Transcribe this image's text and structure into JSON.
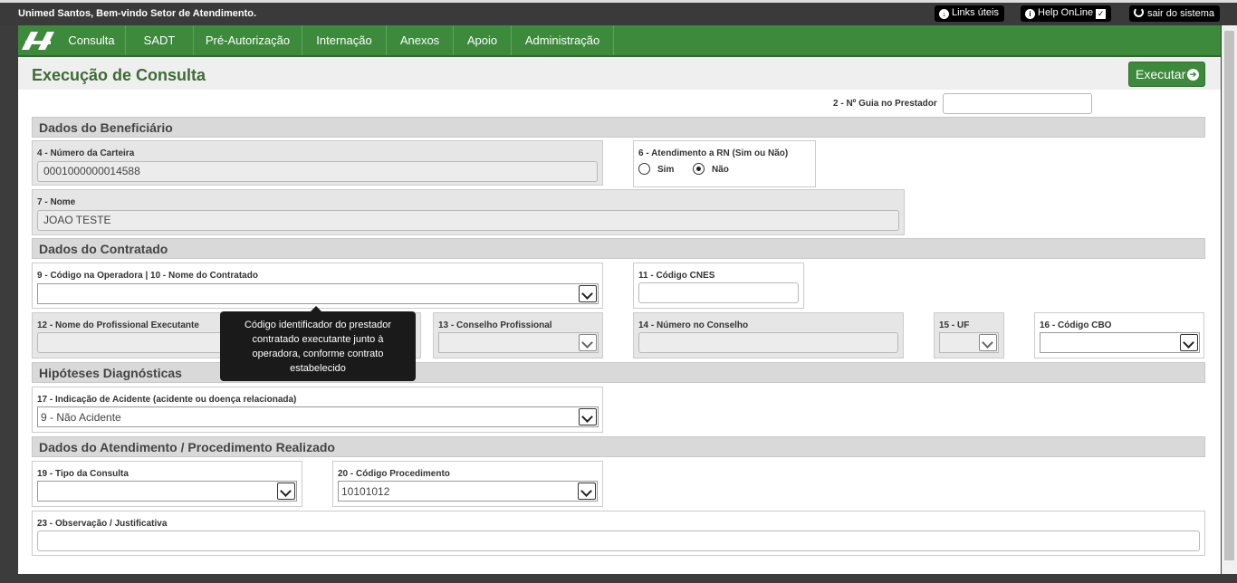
{
  "header": {
    "welcome": "Unimed Santos, Bem-vindo Setor de Atendimento.",
    "links_uteis": "Links úteis",
    "help_online": "Help OnLine",
    "sair": "sair do sistema"
  },
  "nav": {
    "items": [
      "Consulta",
      "SADT",
      "Pré-Autorização",
      "Internação",
      "Anexos",
      "Apoio",
      "Administração"
    ]
  },
  "page": {
    "title": "Execução de Consulta",
    "execute_label": "Executar",
    "guia_label": "2 - Nº Guia no Prestador",
    "guia_value": ""
  },
  "sections": {
    "beneficiario": "Dados do Beneficiário",
    "contratado": "Dados do Contratado",
    "hipoteses": "Hipóteses Diagnósticas",
    "atendimento": "Dados do Atendimento / Procedimento Realizado"
  },
  "fields": {
    "carteira_label": "4 - Número da Carteira",
    "carteira_value": "0001000000014588",
    "rn_label": "6 - Atendimento a RN (Sim ou Não)",
    "rn_sim": "Sim",
    "rn_nao": "Não",
    "rn_selected": "Não",
    "nome_label": "7 - Nome",
    "nome_value": "JOAO TESTE",
    "codigo_operadora_label": "9 - Código na Operadora | 10 - Nome do Contratado",
    "codigo_operadora_value": "",
    "cnes_label": "11 - Código CNES",
    "cnes_value": "",
    "profissional_label": "12 - Nome do Profissional Executante",
    "conselho_label": "13 - Conselho Profissional",
    "numero_conselho_label": "14 - Número no Conselho",
    "uf_label": "15 - UF",
    "cbo_label": "16 - Código CBO",
    "acidente_label": "17 - Indicação de Acidente (acidente ou doença relacionada)",
    "acidente_value": "9 - Não Acidente",
    "tipo_consulta_label": "19 - Tipo da Consulta",
    "tipo_consulta_value": "",
    "procedimento_label": "20 - Código Procedimento",
    "procedimento_value": "10101012",
    "observacao_label": "23 - Observação / Justificativa",
    "observacao_value": ""
  },
  "tooltip": {
    "text": "Código identificador do prestador contratado executante junto à operadora, conforme contrato estabelecido"
  },
  "colors": {
    "nav_green": "#3d8a3d",
    "title_green": "#3d6b35",
    "topbar": "#3a3a3a"
  },
  "icons": {
    "links": "download-circle-icon",
    "help": "info-icon",
    "help_check": "checkbox-icon",
    "sair": "power-icon",
    "execute": "arrow-right-circle-icon",
    "logo": "unimed-logo"
  }
}
